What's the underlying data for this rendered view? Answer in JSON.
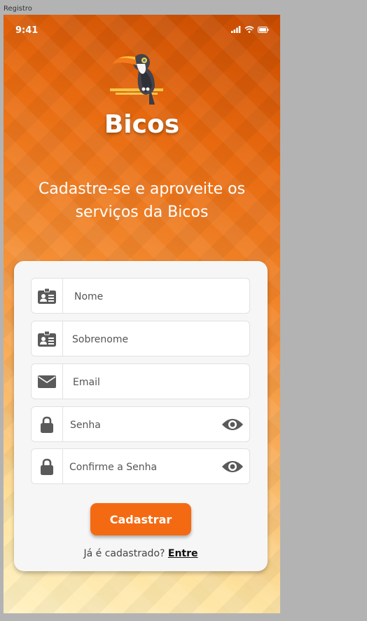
{
  "window": {
    "frame_label": "Registro"
  },
  "status_bar": {
    "time": "9:41"
  },
  "brand": {
    "name": "Bicos"
  },
  "tagline": "Cadastre-se e aproveite os serviços da Bicos",
  "form": {
    "fields": [
      {
        "placeholder": "Nome",
        "icon": "id-card-icon"
      },
      {
        "placeholder": "Sobrenome",
        "icon": "id-card-icon"
      },
      {
        "placeholder": "Email",
        "icon": "envelope-icon"
      },
      {
        "placeholder": "Senha",
        "icon": "lock-icon"
      },
      {
        "placeholder": "Confirme a Senha",
        "icon": "lock-icon"
      }
    ],
    "submit_label": "Cadastrar",
    "login_prompt": "Já é cadastrado?",
    "login_link": "Entre"
  },
  "colors": {
    "accent": "#f46a12",
    "gradient_top": "#c64a00",
    "gradient_bottom": "#fff2c4"
  }
}
